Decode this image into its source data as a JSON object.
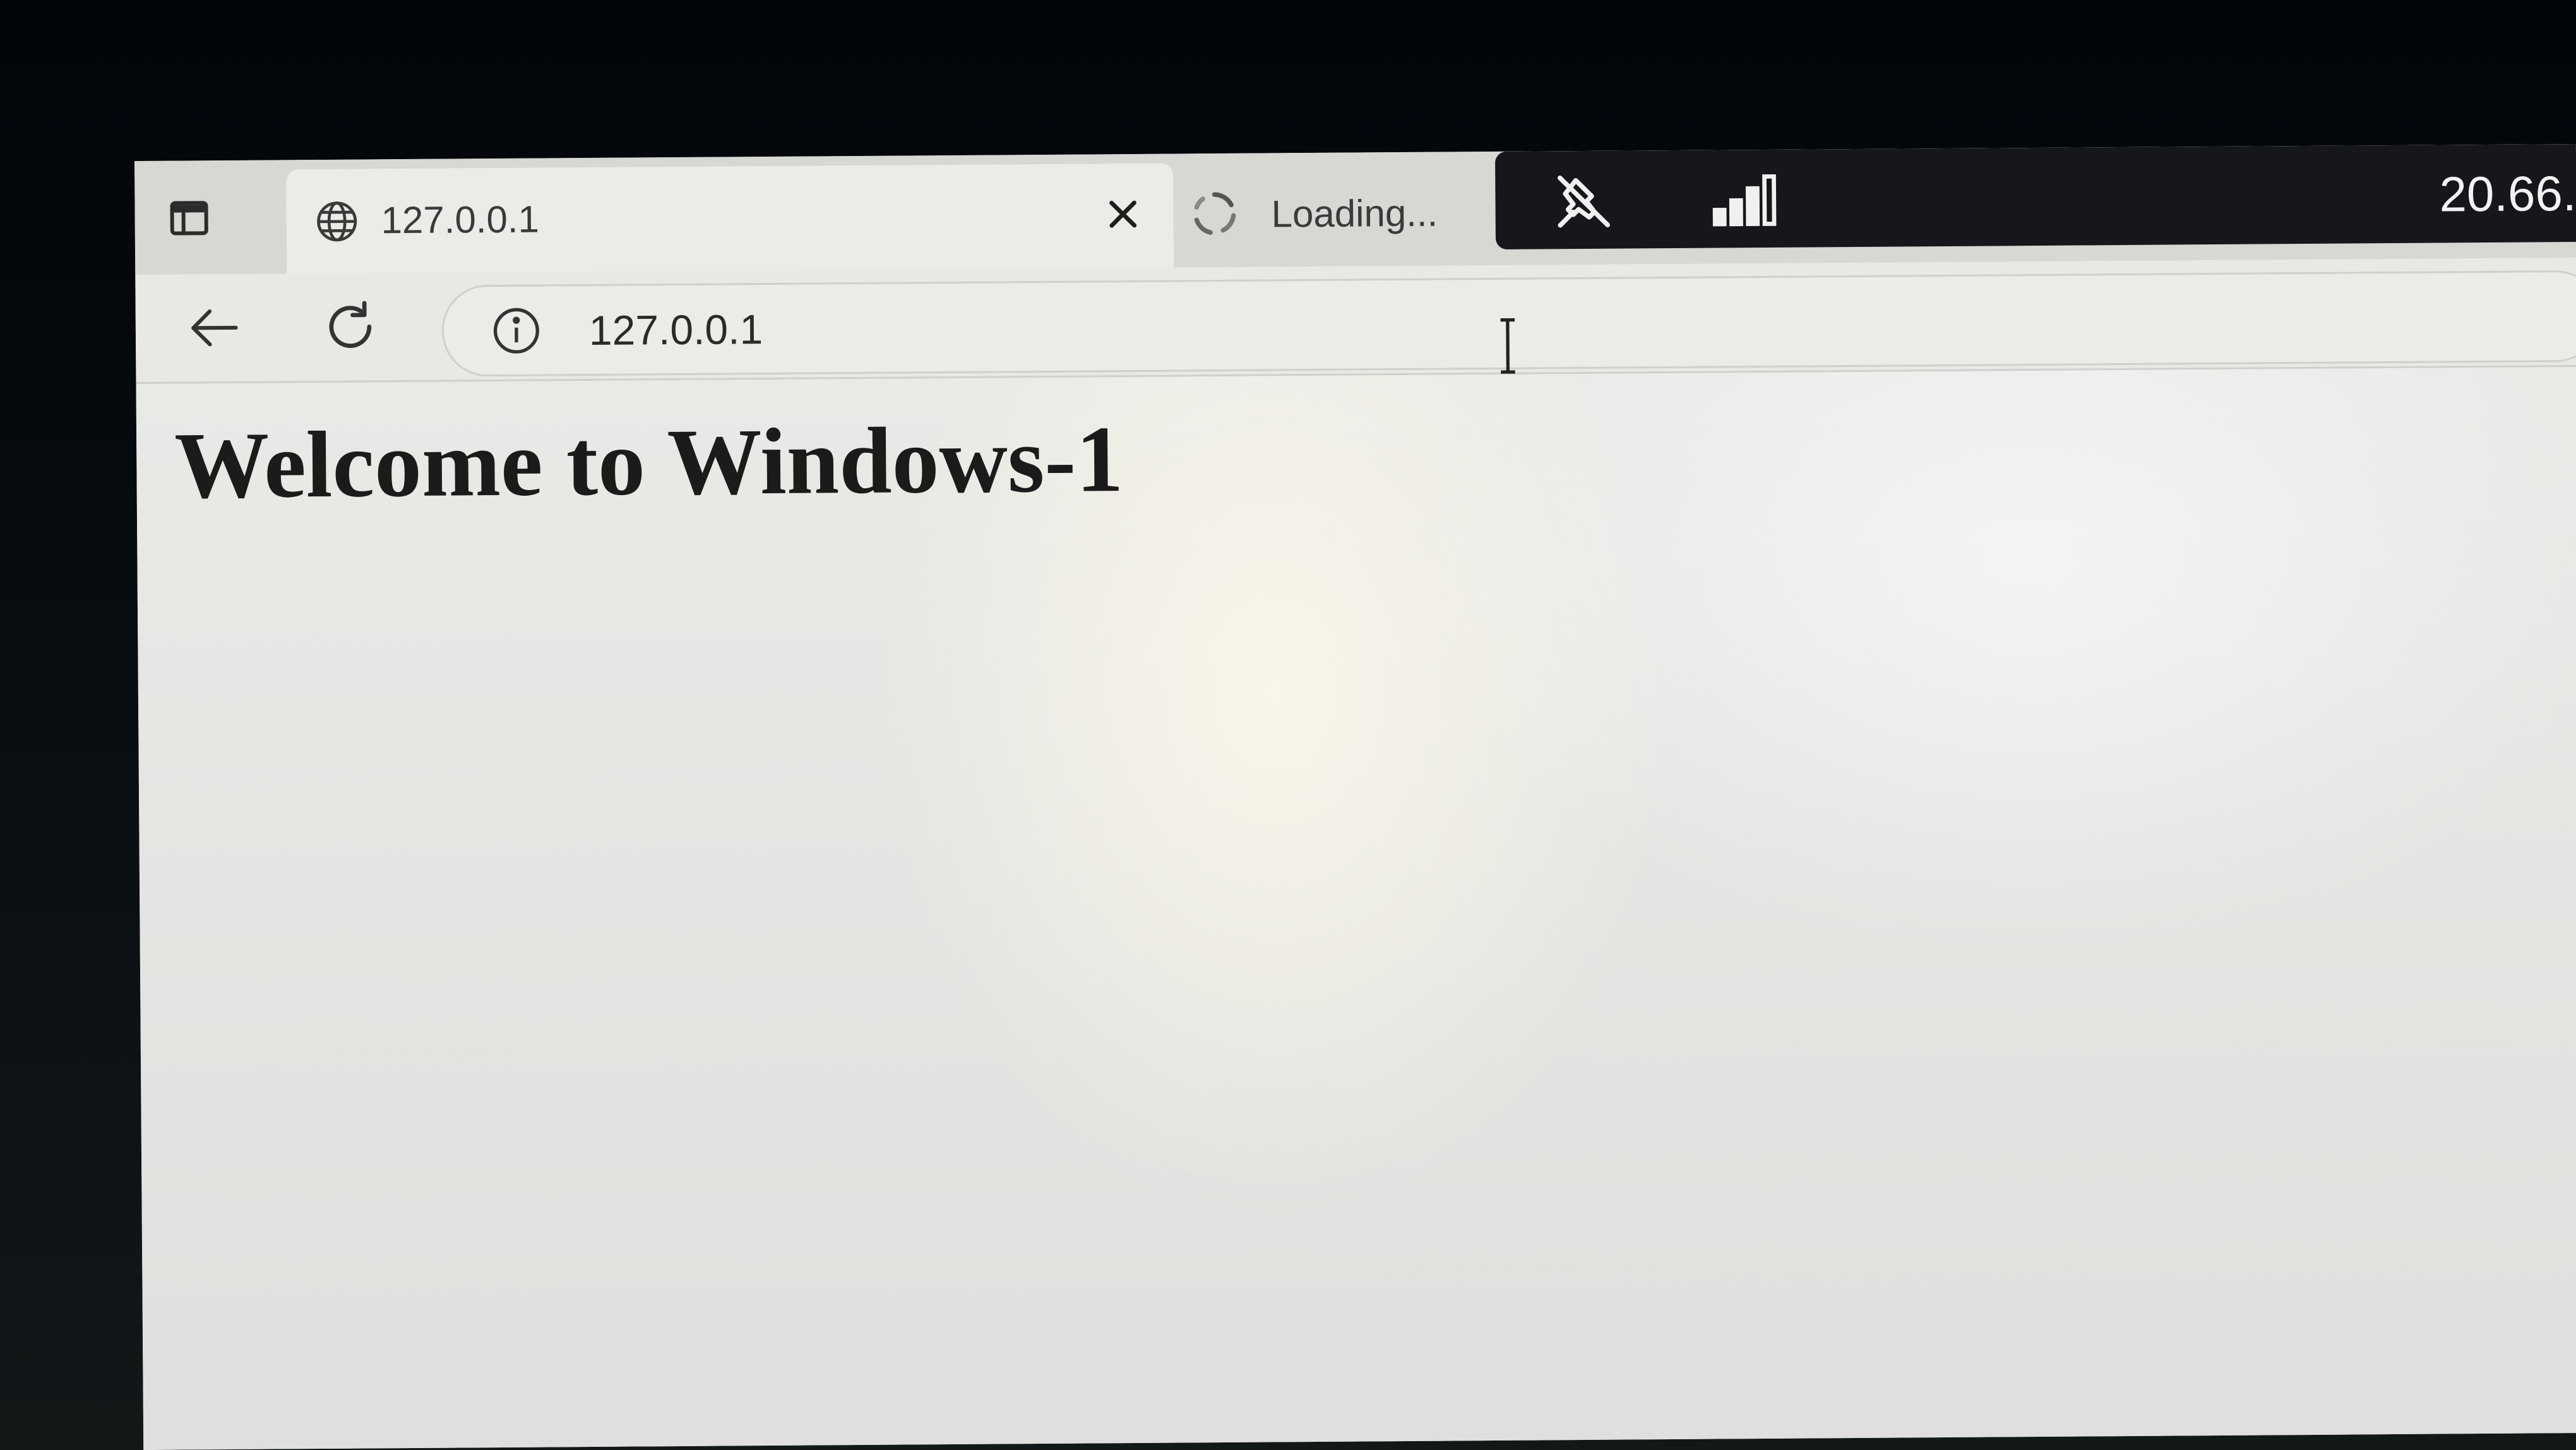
{
  "tabs": [
    {
      "title": "127.0.0.1",
      "icon": "globe-icon",
      "active": true
    },
    {
      "title": "Loading...",
      "icon": "loading-spinner-icon",
      "active": false
    }
  ],
  "system_bar": {
    "icons": [
      "unpin-icon",
      "signal-strength-icon"
    ],
    "value": "20.66."
  },
  "toolbar": {
    "address": "127.0.0.1",
    "site_info_icon": "info-icon"
  },
  "page": {
    "heading": "Welcome to Windows-1"
  }
}
